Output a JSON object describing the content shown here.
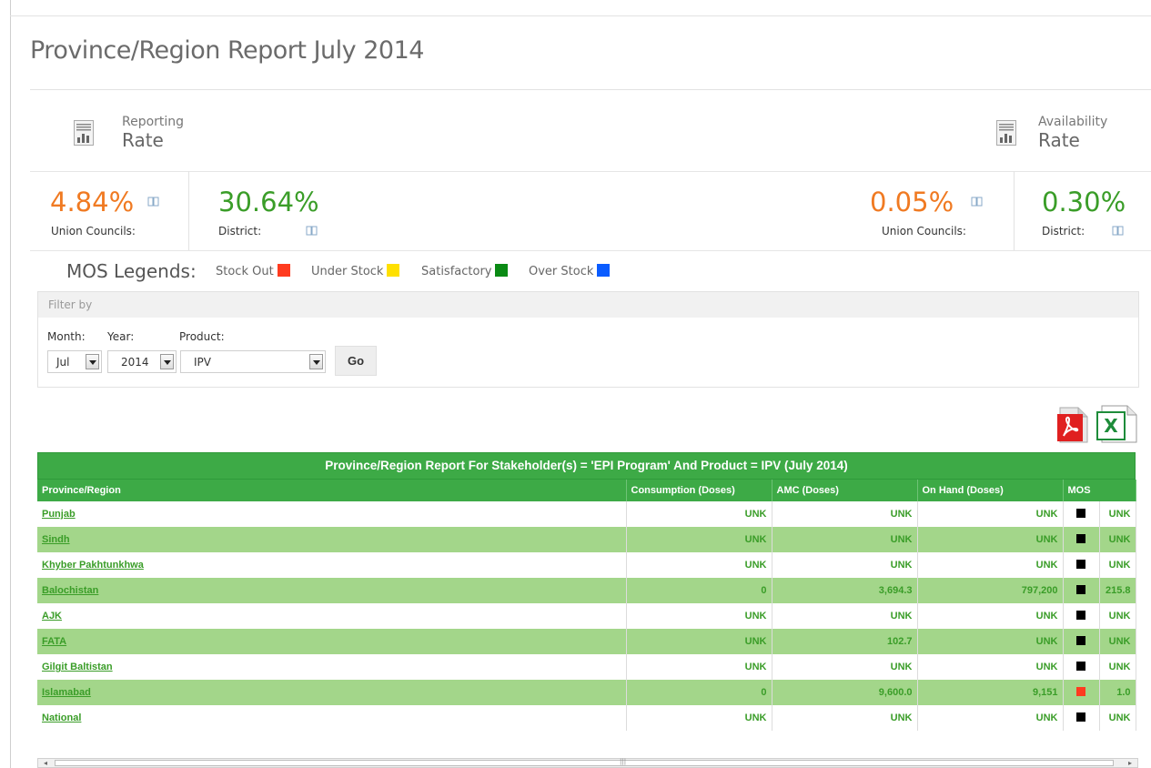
{
  "page": {
    "title": "Province/Region Report July 2014"
  },
  "reporting": {
    "small": "Reporting",
    "big": "Rate",
    "uc_value": "4.84%",
    "uc_label": "Union Councils:",
    "district_value": "30.64%",
    "district_label": "District:"
  },
  "availability": {
    "small": "Availability",
    "big": "Rate",
    "uc_value": "0.05%",
    "uc_label": "Union Councils:",
    "district_value": "0.30%",
    "district_label": "District:"
  },
  "legend": {
    "title": "MOS Legends:",
    "items": [
      {
        "label": "Stock Out",
        "color": "#ff3b1f"
      },
      {
        "label": "Under Stock",
        "color": "#ffe000"
      },
      {
        "label": "Satisfactory",
        "color": "#0a8a14"
      },
      {
        "label": "Over Stock",
        "color": "#0a5cff"
      }
    ]
  },
  "filter": {
    "heading": "Filter by",
    "month_label": "Month:",
    "year_label": "Year:",
    "product_label": "Product:",
    "month_value": "Jul",
    "year_value": "2014",
    "product_value": "IPV",
    "go_label": "Go"
  },
  "report": {
    "title": "Province/Region Report For Stakeholder(s) = 'EPI Program' And Product = IPV (July 2014)",
    "columns": [
      "Province/Region",
      "Consumption (Doses)",
      "AMC (Doses)",
      "On Hand (Doses)",
      "MOS"
    ],
    "rows": [
      {
        "name": "Punjab",
        "consumption": "UNK",
        "amc": "UNK",
        "on_hand": "UNK",
        "mos_color": "#000000",
        "mos": "UNK"
      },
      {
        "name": "Sindh",
        "consumption": "UNK",
        "amc": "UNK",
        "on_hand": "UNK",
        "mos_color": "#000000",
        "mos": "UNK"
      },
      {
        "name": "Khyber Pakhtunkhwa",
        "consumption": "UNK",
        "amc": "UNK",
        "on_hand": "UNK",
        "mos_color": "#000000",
        "mos": "UNK"
      },
      {
        "name": "Balochistan",
        "consumption": "0",
        "amc": "3,694.3",
        "on_hand": "797,200",
        "mos_color": "#000000",
        "mos": "215.8"
      },
      {
        "name": "AJK",
        "consumption": "UNK",
        "amc": "UNK",
        "on_hand": "UNK",
        "mos_color": "#000000",
        "mos": "UNK"
      },
      {
        "name": "FATA",
        "consumption": "UNK",
        "amc": "102.7",
        "on_hand": "UNK",
        "mos_color": "#000000",
        "mos": "UNK"
      },
      {
        "name": "Gilgit Baltistan",
        "consumption": "UNK",
        "amc": "UNK",
        "on_hand": "UNK",
        "mos_color": "#000000",
        "mos": "UNK"
      },
      {
        "name": "Islamabad",
        "consumption": "0",
        "amc": "9,600.0",
        "on_hand": "9,151",
        "mos_color": "#ff3b1f",
        "mos": "1.0"
      },
      {
        "name": "National",
        "consumption": "UNK",
        "amc": "UNK",
        "on_hand": "UNK",
        "mos_color": "#000000",
        "mos": "UNK"
      }
    ]
  },
  "icons": {
    "rate": "bar-chart-doc-icon",
    "book": "book-icon",
    "pdf": "pdf-export-icon",
    "excel": "excel-export-icon"
  }
}
